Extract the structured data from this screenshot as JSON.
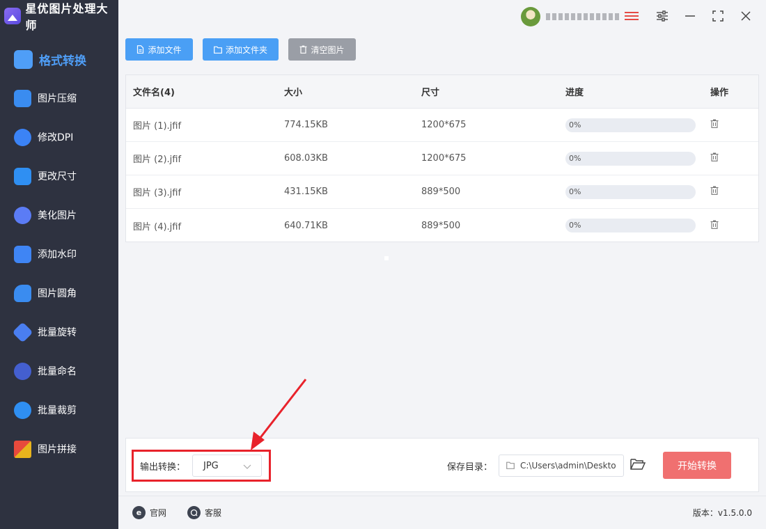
{
  "app": {
    "title": "星优图片处理大师"
  },
  "sidebar": {
    "items": [
      {
        "label": "格式转换",
        "icon": "image-convert-icon",
        "color": "#4f9ef7",
        "active": true
      },
      {
        "label": "图片压缩",
        "icon": "compress-icon",
        "color": "#3a8cf0"
      },
      {
        "label": "修改DPI",
        "icon": "dpi-icon",
        "color": "#3b83f6"
      },
      {
        "label": "更改尺寸",
        "icon": "resize-icon",
        "color": "#2f8ff2"
      },
      {
        "label": "美化图片",
        "icon": "beautify-icon",
        "color": "#5b7cf5"
      },
      {
        "label": "添加水印",
        "icon": "watermark-icon",
        "color": "#3f85f4"
      },
      {
        "label": "图片圆角",
        "icon": "rounded-corner-icon",
        "color": "#3a8cf0"
      },
      {
        "label": "批量旋转",
        "icon": "rotate-icon",
        "color": "#4a7ef0"
      },
      {
        "label": "批量命名",
        "icon": "rename-icon",
        "color": "#445fcf"
      },
      {
        "label": "批量裁剪",
        "icon": "crop-icon",
        "color": "#2f8ff2"
      },
      {
        "label": "图片拼接",
        "icon": "stitch-icon",
        "color": "#e8b41d"
      }
    ]
  },
  "toolbar": {
    "add_file": "添加文件",
    "add_folder": "添加文件夹",
    "clear": "清空图片"
  },
  "table": {
    "headers": [
      "文件名(4)",
      "大小",
      "尺寸",
      "进度",
      "操作"
    ],
    "rows": [
      {
        "name": "图片 (1).jfif",
        "size": "774.15KB",
        "dims": "1200*675",
        "progress": "0%",
        "progress_value": 0
      },
      {
        "name": "图片 (2).jfif",
        "size": "608.03KB",
        "dims": "1200*675",
        "progress": "0%",
        "progress_value": 0
      },
      {
        "name": "图片 (3).jfif",
        "size": "431.15KB",
        "dims": "889*500",
        "progress": "0%",
        "progress_value": 0
      },
      {
        "name": "图片 (4).jfif",
        "size": "640.71KB",
        "dims": "889*500",
        "progress": "0%",
        "progress_value": 0
      }
    ]
  },
  "bottom": {
    "output_label": "输出转换：",
    "format_value": "JPG",
    "save_label": "保存目录：",
    "save_path": "C:\\Users\\admin\\Deskto",
    "start_button": "开始转换"
  },
  "footer": {
    "website": "官网",
    "support": "客服",
    "version": "版本：v1.5.0.0"
  },
  "colors": {
    "sidebar_bg": "#2e3240",
    "accent": "#4a9ff5",
    "start_button": "#f07070",
    "highlight": "#e8222b"
  }
}
